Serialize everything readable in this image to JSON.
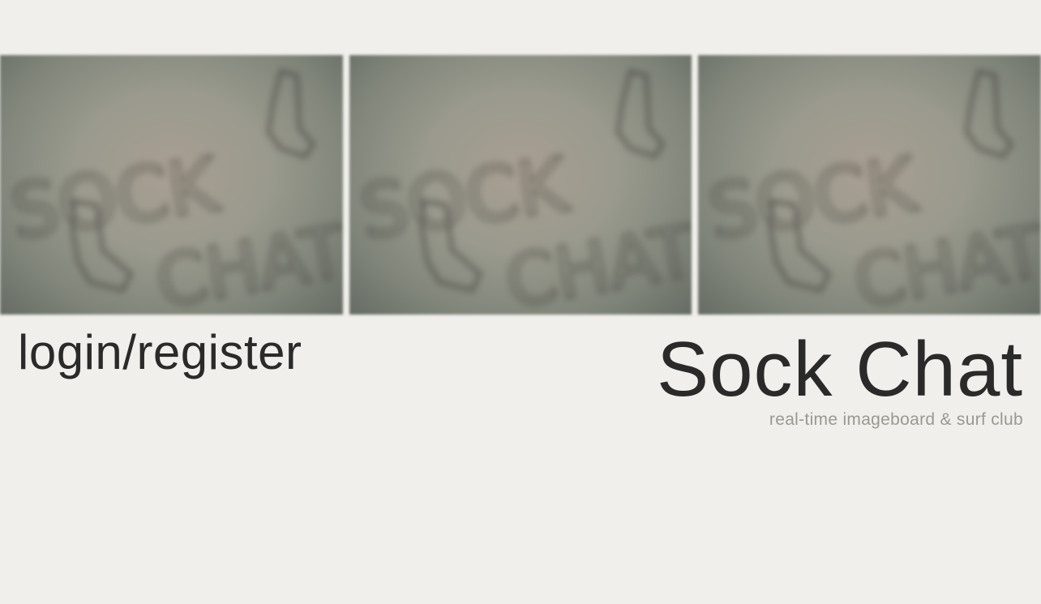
{
  "banner": {
    "image_alt": "SOCK CHAT",
    "tiles": [
      {
        "logo_text_top": "SOCK",
        "logo_text_bottom": "CHAT"
      },
      {
        "logo_text_top": "SOCK",
        "logo_text_bottom": "CHAT"
      },
      {
        "logo_text_top": "SOCK",
        "logo_text_bottom": "CHAT"
      }
    ]
  },
  "auth": {
    "login_label": "login/register"
  },
  "brand": {
    "title": "Sock Chat",
    "subtitle": "real-time imageboard & surf club"
  }
}
